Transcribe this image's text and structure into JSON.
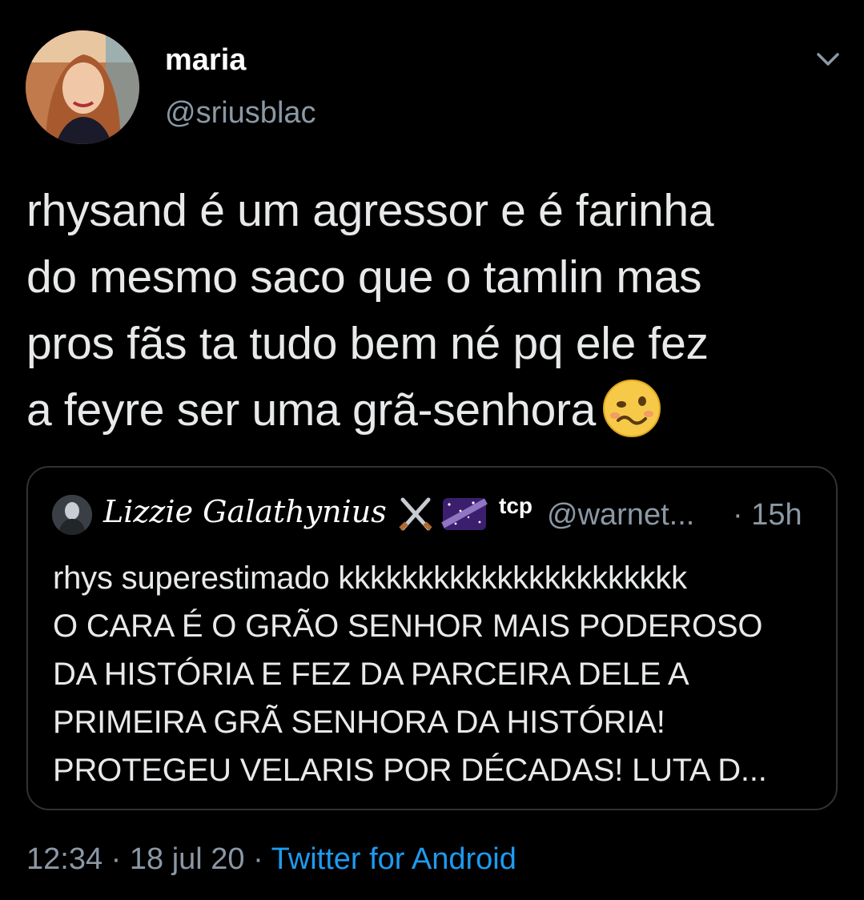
{
  "author": {
    "name": "maria",
    "handle": "@sriusblac"
  },
  "tweet": {
    "text_lines": [
      "rhysand é um agressor e é farinha",
      "do mesmo saco que o tamlin mas",
      "pros fãs ta tudo bem né pq ele fez",
      "a feyre ser uma grã-senhora"
    ],
    "trailing_emoji": "woozy-face"
  },
  "quoted_tweet": {
    "name": "Lizzie Galathynius",
    "name_emojis": [
      "crossed-swords",
      "milky-way"
    ],
    "badge": "tcp",
    "handle": "@warnet...",
    "separator": "·",
    "time": "15h",
    "text_lines": [
      "rhys superestimado kkkkkkkkkkkkkkkkkkkkkk",
      "O CARA É O GRÃO SENHOR MAIS PODEROSO",
      "DA HISTÓRIA E FEZ DA PARCEIRA DELE A",
      "PRIMEIRA GRÃ SENHORA DA HISTÓRIA!",
      "PROTEGEU VELARIS POR DÉCADAS! LUTA D..."
    ]
  },
  "meta": {
    "time": "12:34",
    "sep1": " · ",
    "date": "18 jul 20",
    "sep2": " · ",
    "source": "Twitter for Android"
  },
  "colors": {
    "background": "#000000",
    "secondary_text": "#8b98a5",
    "link": "#1d9bf0",
    "border": "#2f3336"
  }
}
